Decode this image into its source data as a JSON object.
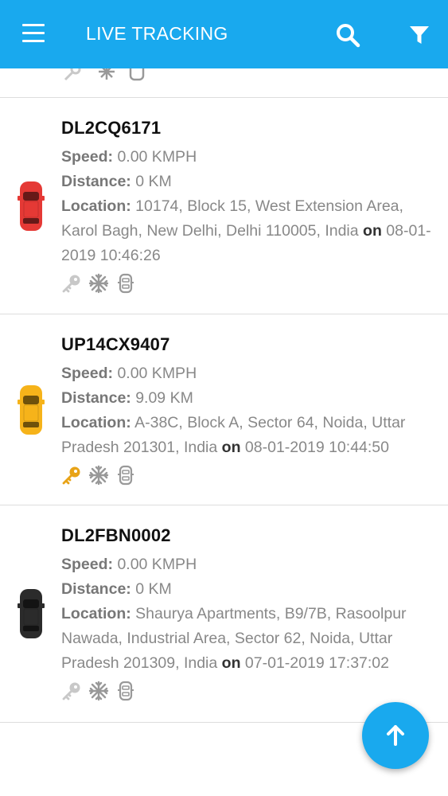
{
  "header": {
    "title": "LIVE TRACKING",
    "bg_color": "#19a9ee",
    "icons": [
      "menu-icon",
      "search-icon",
      "filter-icon"
    ]
  },
  "labels": {
    "speed": "Speed:",
    "distance": "Distance:",
    "location": "Location:",
    "on": "on"
  },
  "vehicles": [
    {
      "plate": "DL2CQ6171",
      "speed": "0.00 KMPH",
      "distance": "0 KM",
      "location": "10174, Block 15, West Extension Area, Karol Bagh, New Delhi, Delhi 110005, India",
      "timestamp": "08-01-2019 10:46:26",
      "car_color": "#e53935",
      "ignition": "off"
    },
    {
      "plate": "UP14CX9407",
      "speed": "0.00 KMPH",
      "distance": "9.09 KM",
      "location": "A-38C, Block A, Sector 64, Noida, Uttar Pradesh 201301, India",
      "timestamp": "08-01-2019 10:44:50",
      "car_color": "#f6b31a",
      "ignition": "on"
    },
    {
      "plate": "DL2FBN0002",
      "speed": "0.00 KMPH",
      "distance": "0 KM",
      "location": "Shaurya Apartments, B9/7B, Rasoolpur Nawada, Industrial Area, Sector 62, Noida, Uttar Pradesh 201309, India",
      "timestamp": "07-01-2019 17:37:02",
      "car_color": "#2b2b2b",
      "ignition": "off"
    }
  ],
  "status_colors": {
    "key_on": "#e8a317",
    "key_off": "#c8c8c8",
    "icon_gray": "#999999"
  }
}
